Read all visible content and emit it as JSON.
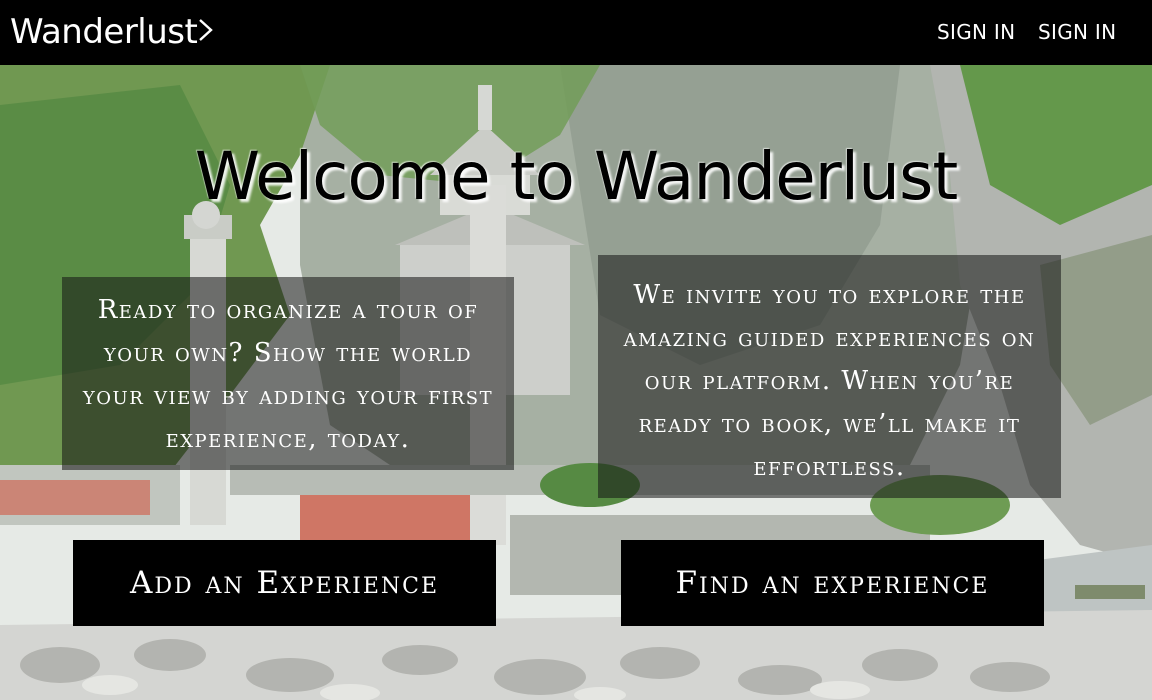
{
  "navbar": {
    "logo": "Wanderlust",
    "links": [
      "SIGN IN",
      "SIGN IN"
    ]
  },
  "hero": {
    "headline": "Welcome to Wanderlust",
    "left_text": "Ready to organize a tour of your own? Show the world your view by adding your first experience, today.",
    "right_text": "We invite you to explore the amazing guided experiences on our platform. When you’re ready to book, we’ll make it effortless.",
    "buttons": {
      "add": "Add an Experience",
      "find": "Find an experience"
    }
  },
  "icons": {
    "logo_arrow": "chevron-right-icon"
  },
  "colors": {
    "navbar": "#000000",
    "button": "#000000",
    "text_light": "#ffffff",
    "overlay": "#141414"
  }
}
